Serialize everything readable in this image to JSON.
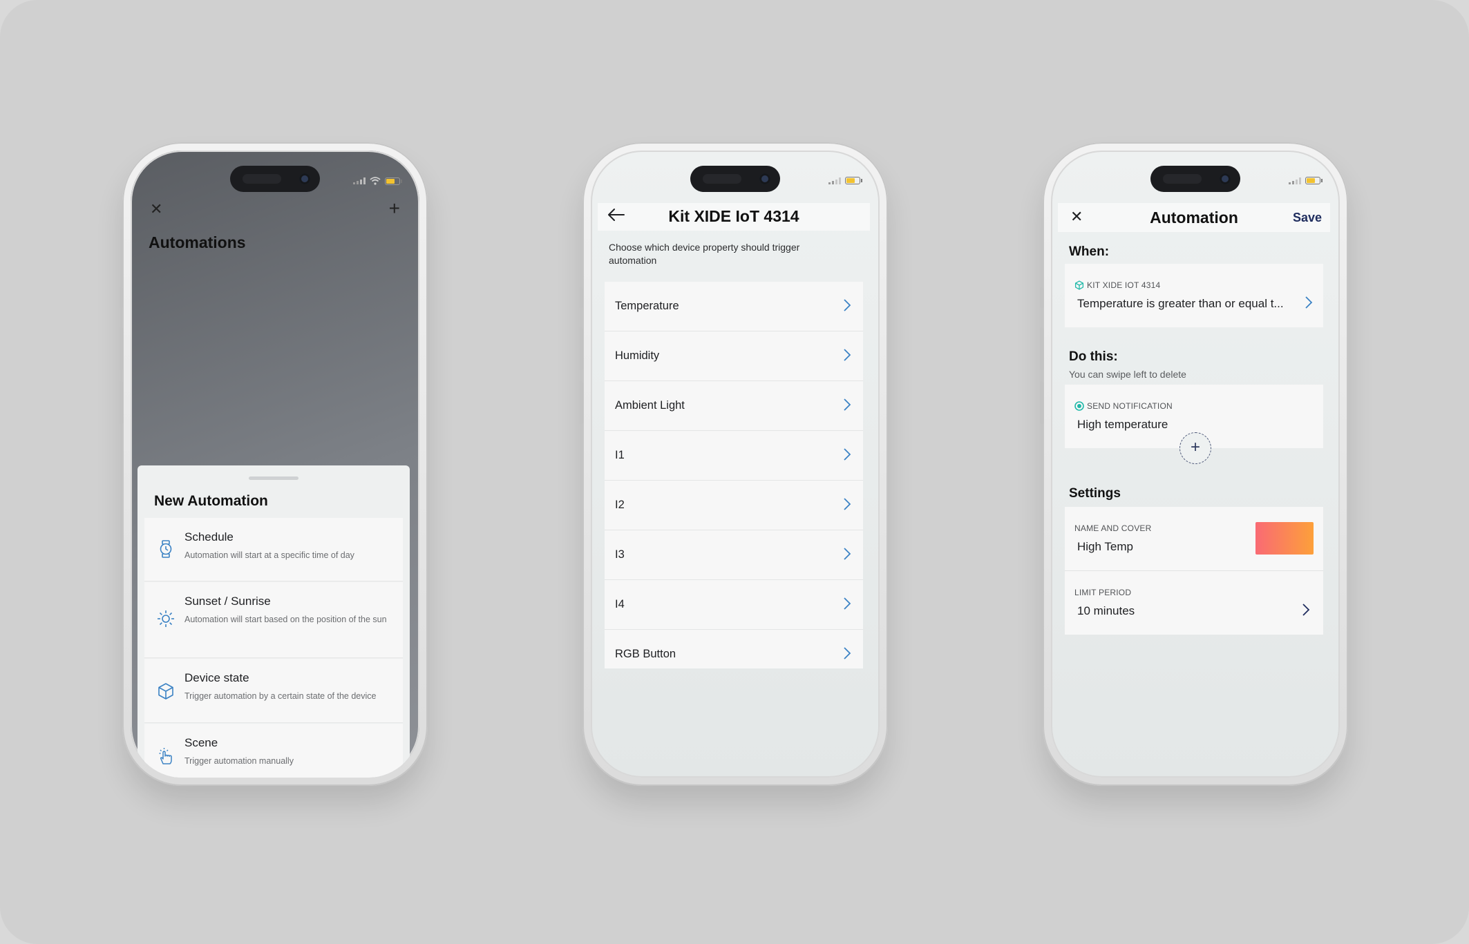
{
  "phone1": {
    "screen_title": "Automations",
    "sheet": {
      "title": "New Automation",
      "options": [
        {
          "icon": "watch-icon",
          "title": "Schedule",
          "description": "Automation will start at a specific time of day"
        },
        {
          "icon": "sun-icon",
          "title": "Sunset / Sunrise",
          "description": "Automation will start based on the position of the sun"
        },
        {
          "icon": "cube-icon",
          "title": "Device state",
          "description": "Trigger automation by a certain state of the device"
        },
        {
          "icon": "hand-tap-icon",
          "title": "Scene",
          "description": "Trigger automation manually"
        }
      ]
    }
  },
  "phone2": {
    "title": "Kit XIDE IoT 4314",
    "hint": "Choose which device property should trigger automation",
    "properties": [
      "Temperature",
      "Humidity",
      "Ambient Light",
      "I1",
      "I2",
      "I3",
      "I4",
      "RGB Button"
    ]
  },
  "phone3": {
    "title": "Automation",
    "save_label": "Save",
    "when_heading": "When:",
    "when_card": {
      "label": "KIT XIDE IOT 4314",
      "value": "Temperature is greater than or equal t..."
    },
    "do_heading": "Do this:",
    "do_hint": "You can swipe left to delete",
    "action_card": {
      "label": "SEND NOTIFICATION",
      "value": "High temperature"
    },
    "add_symbol": "+",
    "settings_heading": "Settings",
    "name_cover": {
      "label": "NAME AND COVER",
      "value": "High Temp",
      "cover_colors": [
        "#f96a74",
        "#fda03a"
      ]
    },
    "limit_period": {
      "label": "LIMIT PERIOD",
      "value": "10 minutes"
    }
  },
  "colors": {
    "accent": "#3b82c4",
    "teal": "#1fb8a8",
    "save": "#1f2d5e",
    "background": "#d0d0d0"
  }
}
